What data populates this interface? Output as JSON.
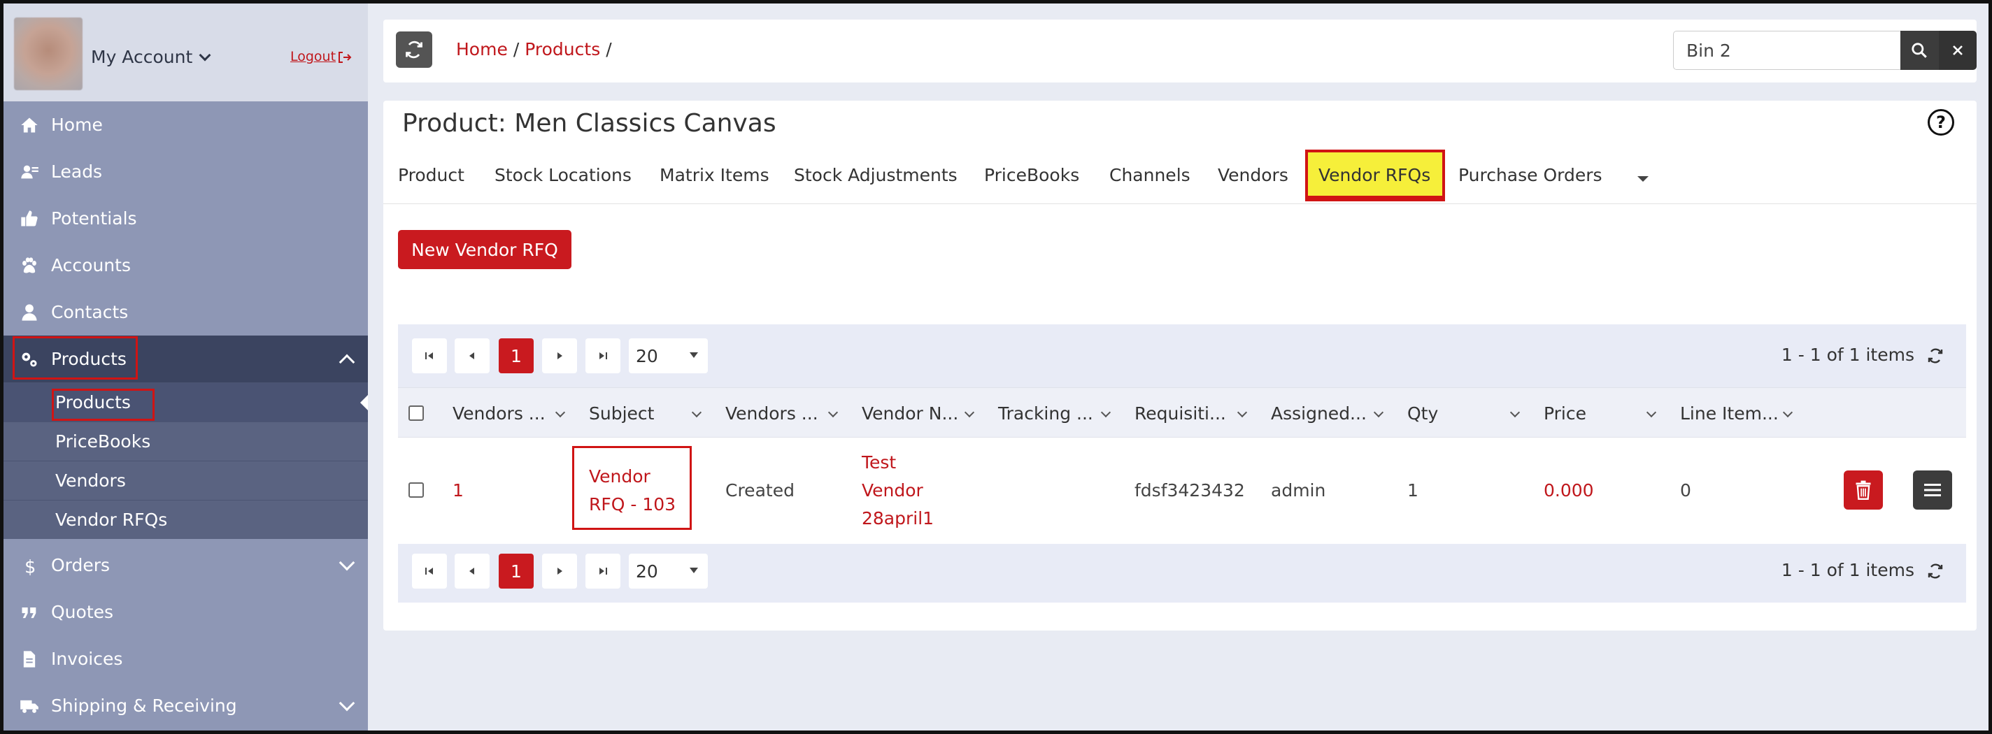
{
  "sidebar": {
    "account_name": "My Account",
    "logout_label": "Logout",
    "items": [
      {
        "label": "Home",
        "icon": "home-icon"
      },
      {
        "label": "Leads",
        "icon": "leads-icon"
      },
      {
        "label": "Potentials",
        "icon": "thumbs-up-icon"
      },
      {
        "label": "Accounts",
        "icon": "paw-icon"
      },
      {
        "label": "Contacts",
        "icon": "user-icon"
      },
      {
        "label": "Products",
        "icon": "gears-icon"
      },
      {
        "label": "Orders",
        "icon": "dollar-icon"
      },
      {
        "label": "Quotes",
        "icon": "quote-icon"
      },
      {
        "label": "Invoices",
        "icon": "file-icon"
      },
      {
        "label": "Shipping & Receiving",
        "icon": "truck-icon"
      }
    ],
    "products_sub": [
      "Products",
      "PriceBooks",
      "Vendors",
      "Vendor RFQs"
    ]
  },
  "topbar": {
    "breadcrumb": [
      "Home",
      "Products"
    ],
    "search_value": "Bin 2"
  },
  "page": {
    "title": "Product: Men Classics Canvas",
    "tabs": [
      "Product",
      "Stock Locations",
      "Matrix Items",
      "Stock Adjustments",
      "PriceBooks",
      "Channels",
      "Vendors",
      "Vendor RFQs",
      "Purchase Orders"
    ],
    "active_tab": "Vendor RFQs",
    "new_button": "New Vendor RFQ"
  },
  "grid": {
    "pager": {
      "current_page": "1",
      "page_size": "20",
      "info": "1 - 1 of 1 items"
    },
    "columns": [
      "Vendors ...",
      "Subject",
      "Vendors ...",
      "Vendor N...",
      "Tracking ...",
      "Requisiti...",
      "Assigned...",
      "Qty",
      "Price",
      "Line Item..."
    ],
    "row": {
      "vendors_no": "1",
      "subject_line1": "Vendor",
      "subject_line2": "RFQ - 103",
      "status": "Created",
      "vendor_name_line1": "Test",
      "vendor_name_line2": "Vendor",
      "vendor_name_line3": "28april1",
      "tracking": "",
      "requisition": "fdsf3423432",
      "assigned": "admin",
      "qty": "1",
      "price": "0.000",
      "line_items": "0"
    }
  },
  "colors": {
    "accent_red": "#c91a1f",
    "sidebar_bg": "#8e97b5",
    "highlight_yellow": "#f6ef3a"
  }
}
